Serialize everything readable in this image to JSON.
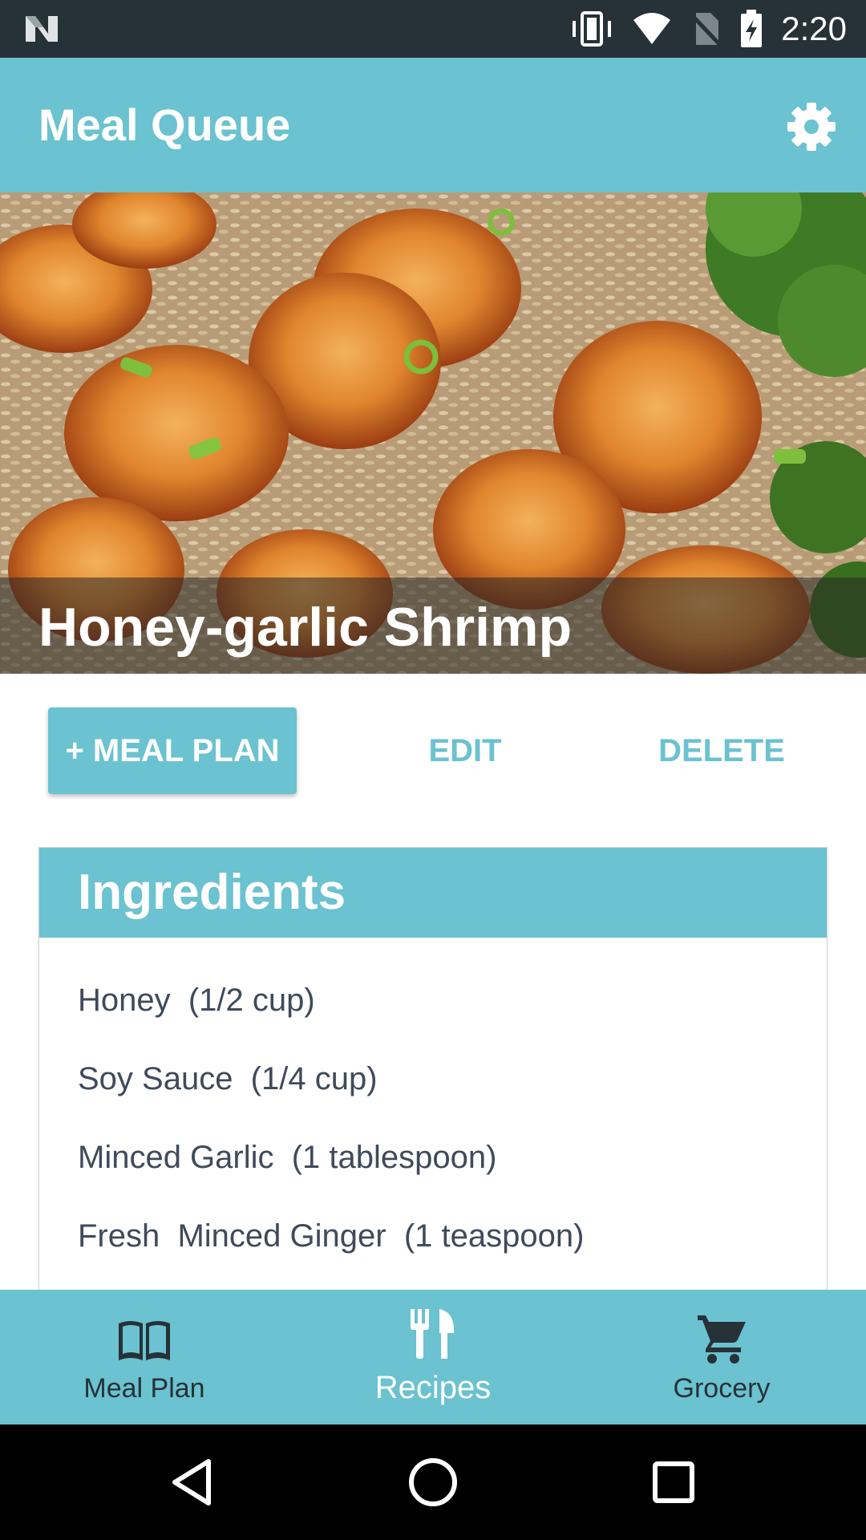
{
  "status_bar": {
    "time": "2:20"
  },
  "app_bar": {
    "title": "Meal Queue"
  },
  "recipe": {
    "title": "Honey-garlic Shrimp",
    "actions": {
      "add_meal_plan": "+ MEAL PLAN",
      "edit": "EDIT",
      "delete": "DELETE"
    }
  },
  "ingredients": {
    "header": "Ingredients",
    "items": [
      "Honey  (1/2 cup)",
      "Soy Sauce  (1/4 cup)",
      "Minced Garlic  (1 tablespoon)",
      "Fresh  Minced Ginger  (1 teaspoon)"
    ]
  },
  "bottom_nav": {
    "items": [
      {
        "label": "Meal Plan",
        "icon": "book-icon",
        "active": false
      },
      {
        "label": "Recipes",
        "icon": "fork-knife-icon",
        "active": true
      },
      {
        "label": "Grocery",
        "icon": "cart-icon",
        "active": false
      }
    ]
  },
  "colors": {
    "primary": "#6bc2d0",
    "status_bar": "#263238",
    "ingredient_text": "#3f4a5a"
  }
}
